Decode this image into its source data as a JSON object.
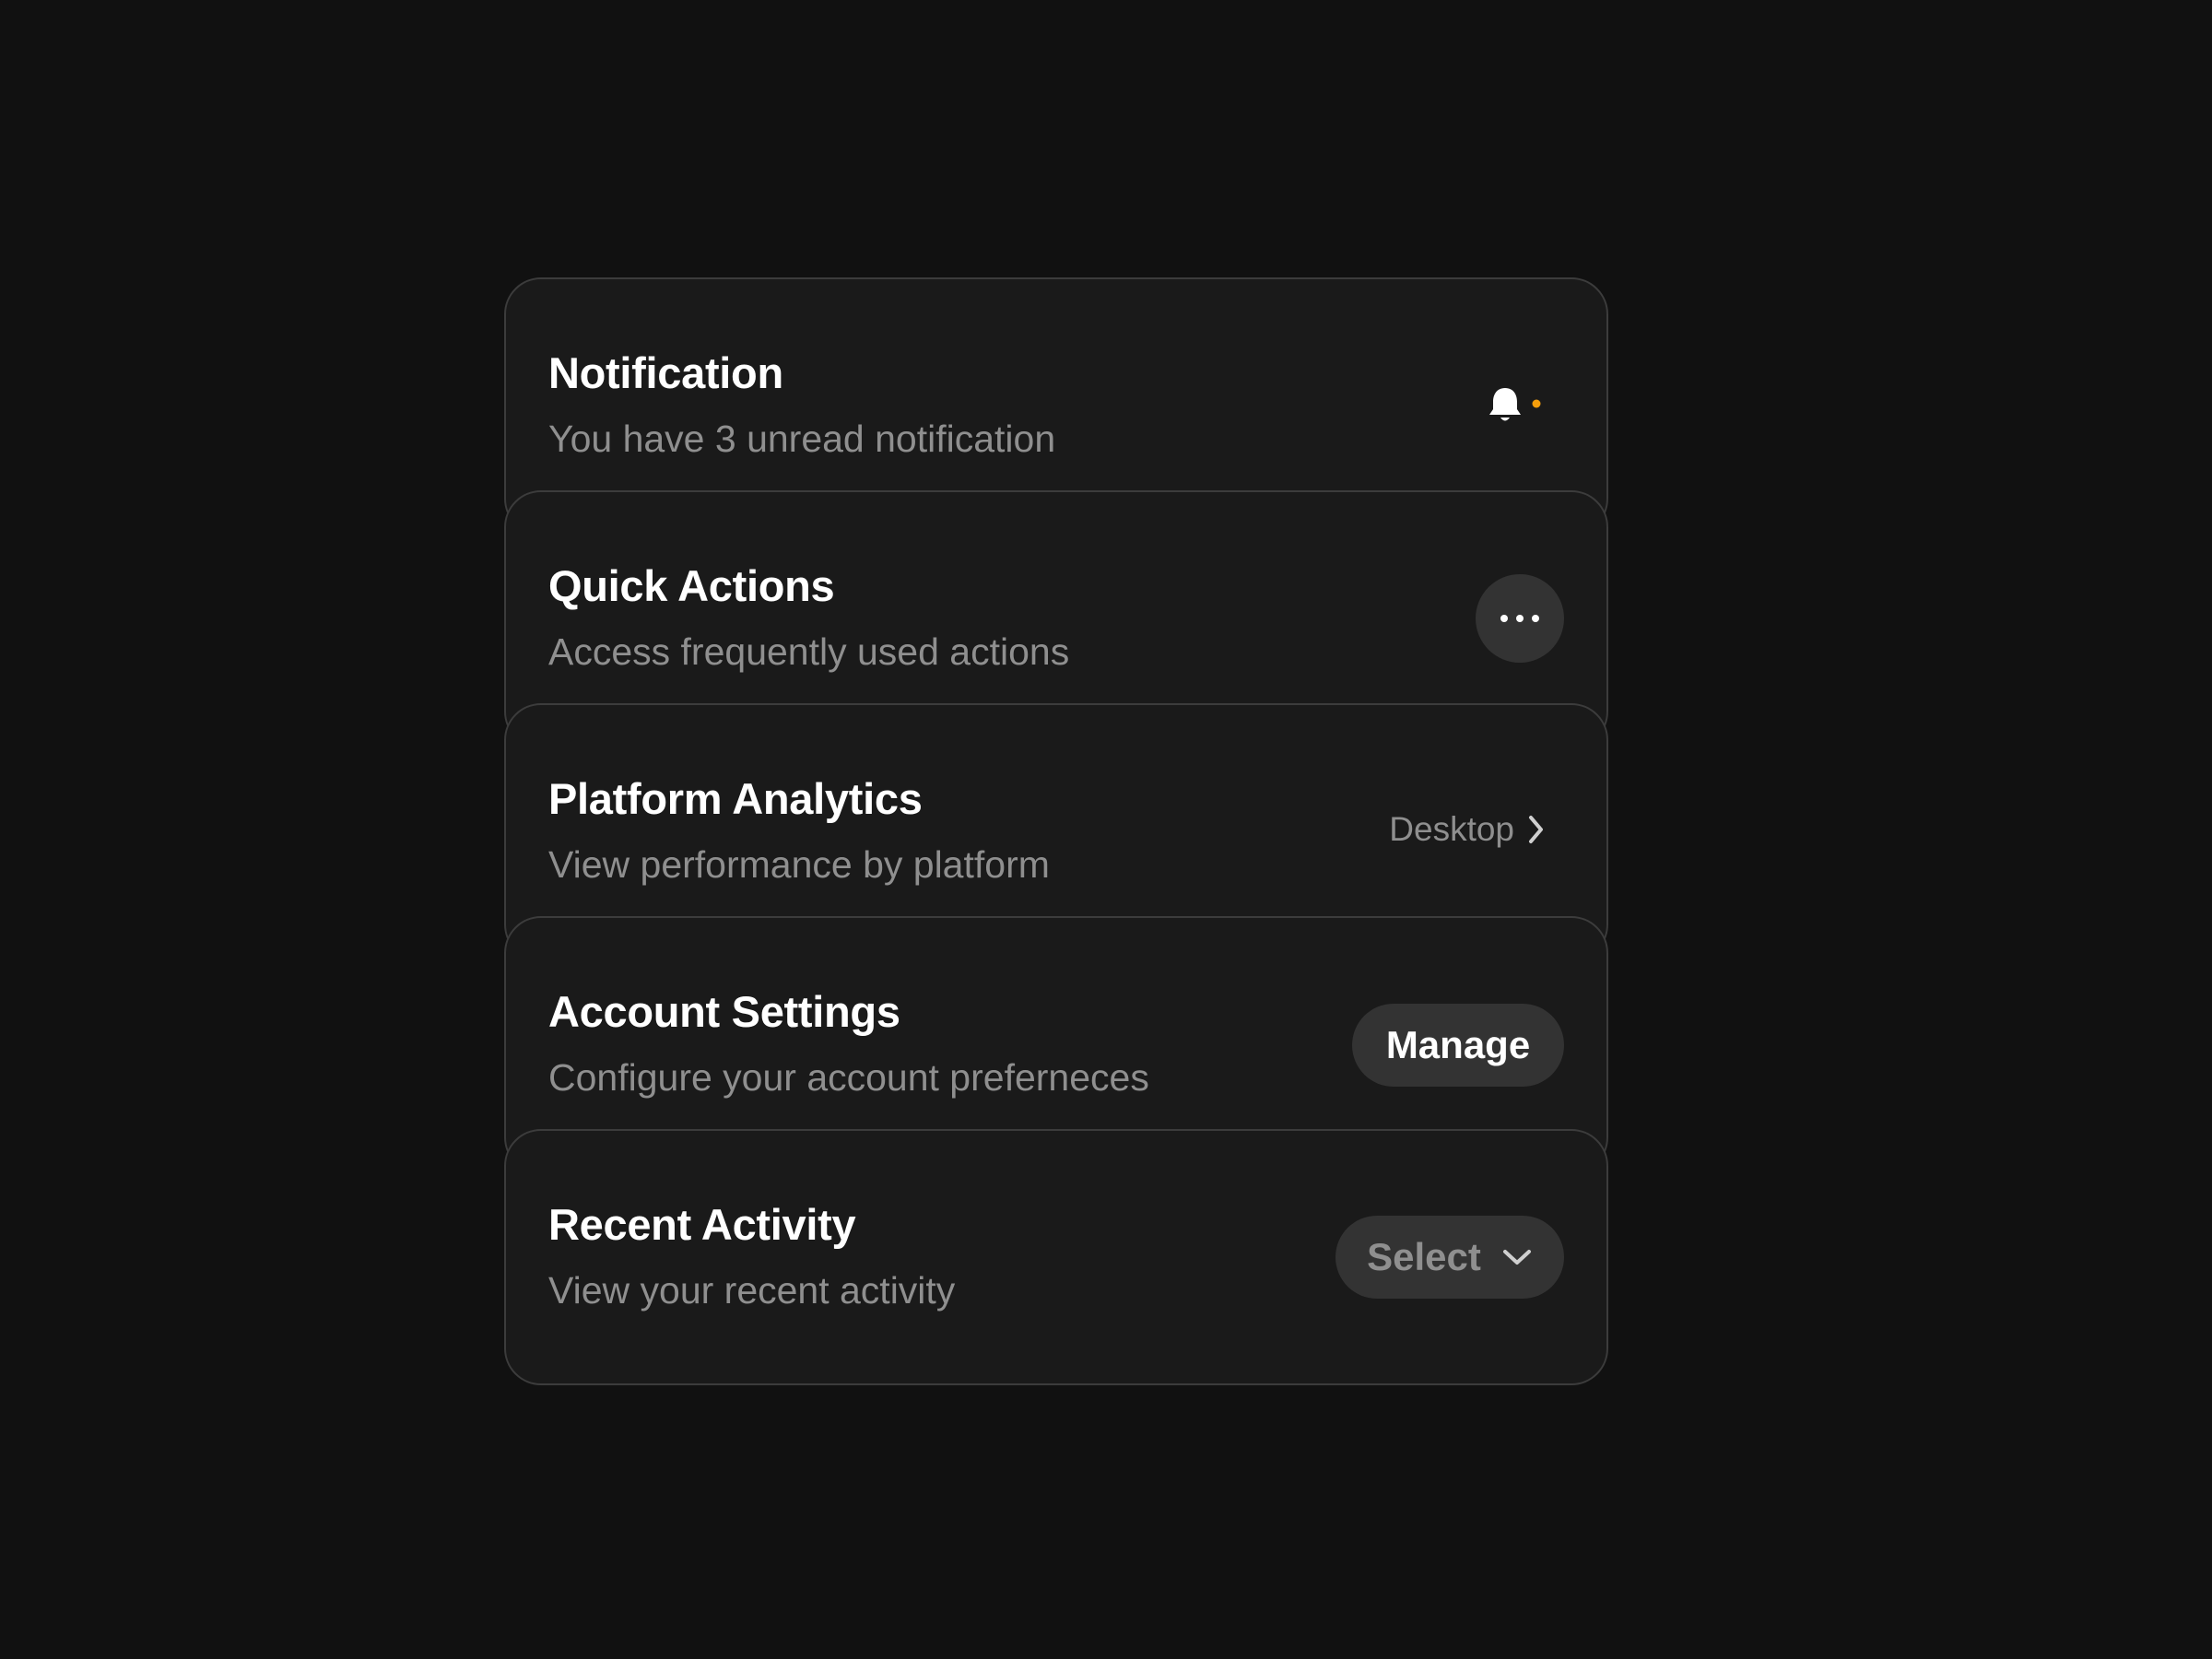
{
  "colors": {
    "background": "#111111",
    "card": "#1a1a1a",
    "card_border": "#3c3c3c",
    "title": "#ffffff",
    "description": "#8f8f8f",
    "button_bg": "#333333",
    "notification_dot": "#f59e0b"
  },
  "cards": {
    "notification": {
      "title": "Notification",
      "description": "You have 3 unread notification",
      "icon": "bell-icon"
    },
    "quick_actions": {
      "title": "Quick Actions",
      "description": "Access frequently used actions",
      "icon": "more-horizontal-icon"
    },
    "platform_analytics": {
      "title": "Platform Analytics",
      "description": "View performance by platform",
      "link_label": "Desktop",
      "icon": "chevron-right-icon"
    },
    "account_settings": {
      "title": "Account Settings",
      "description": "Configure your account preferneces",
      "button_label": "Manage"
    },
    "recent_activity": {
      "title": "Recent Activity",
      "description": "View your recent activity",
      "select_value": "Select",
      "icon": "chevron-down-icon"
    }
  }
}
